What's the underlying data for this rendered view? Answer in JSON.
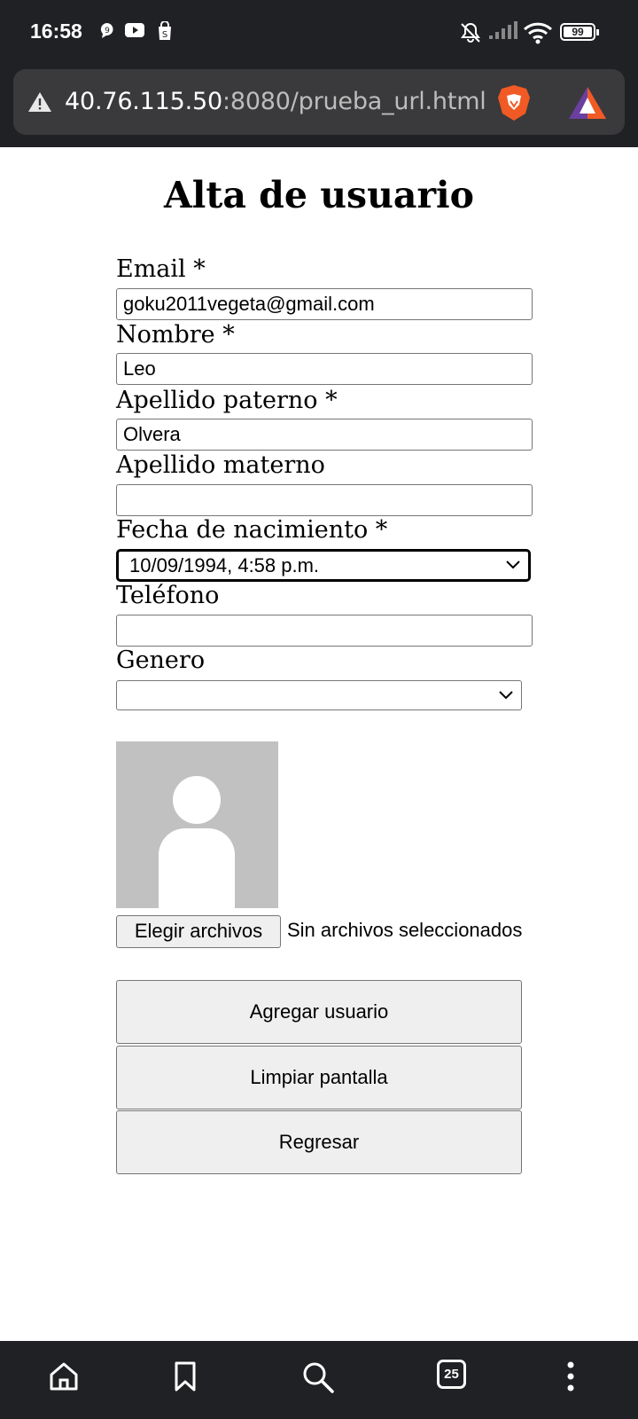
{
  "status_bar": {
    "time": "16:58",
    "battery": "99"
  },
  "browser": {
    "url_host": "40.76.115.50",
    "url_rest": ":8080/prueba_url.html",
    "tabs_count": "25"
  },
  "page": {
    "title": "Alta de usuario",
    "fields": {
      "email": {
        "label": "Email *",
        "value": "goku2011vegeta@gmail.com"
      },
      "nombre": {
        "label": "Nombre *",
        "value": "Leo"
      },
      "apellido_paterno": {
        "label": "Apellido paterno *",
        "value": "Olvera"
      },
      "apellido_materno": {
        "label": "Apellido materno",
        "value": ""
      },
      "fecha_nacimiento": {
        "label": "Fecha de nacimiento *",
        "value": "10/09/1994, 4:58 p.m."
      },
      "telefono": {
        "label": "Teléfono",
        "value": ""
      },
      "genero": {
        "label": "Genero",
        "value": ""
      }
    },
    "file": {
      "button_label": "Elegir archivos",
      "status": "Sin archivos seleccionados"
    },
    "actions": {
      "add": "Agregar usuario",
      "clear": "Limpiar pantalla",
      "back": "Regresar"
    }
  },
  "colors": {
    "system_bar": "#202124",
    "url_field": "#3a3a3c",
    "button_bg": "#efefef",
    "avatar_bg": "#c1c1c1"
  }
}
